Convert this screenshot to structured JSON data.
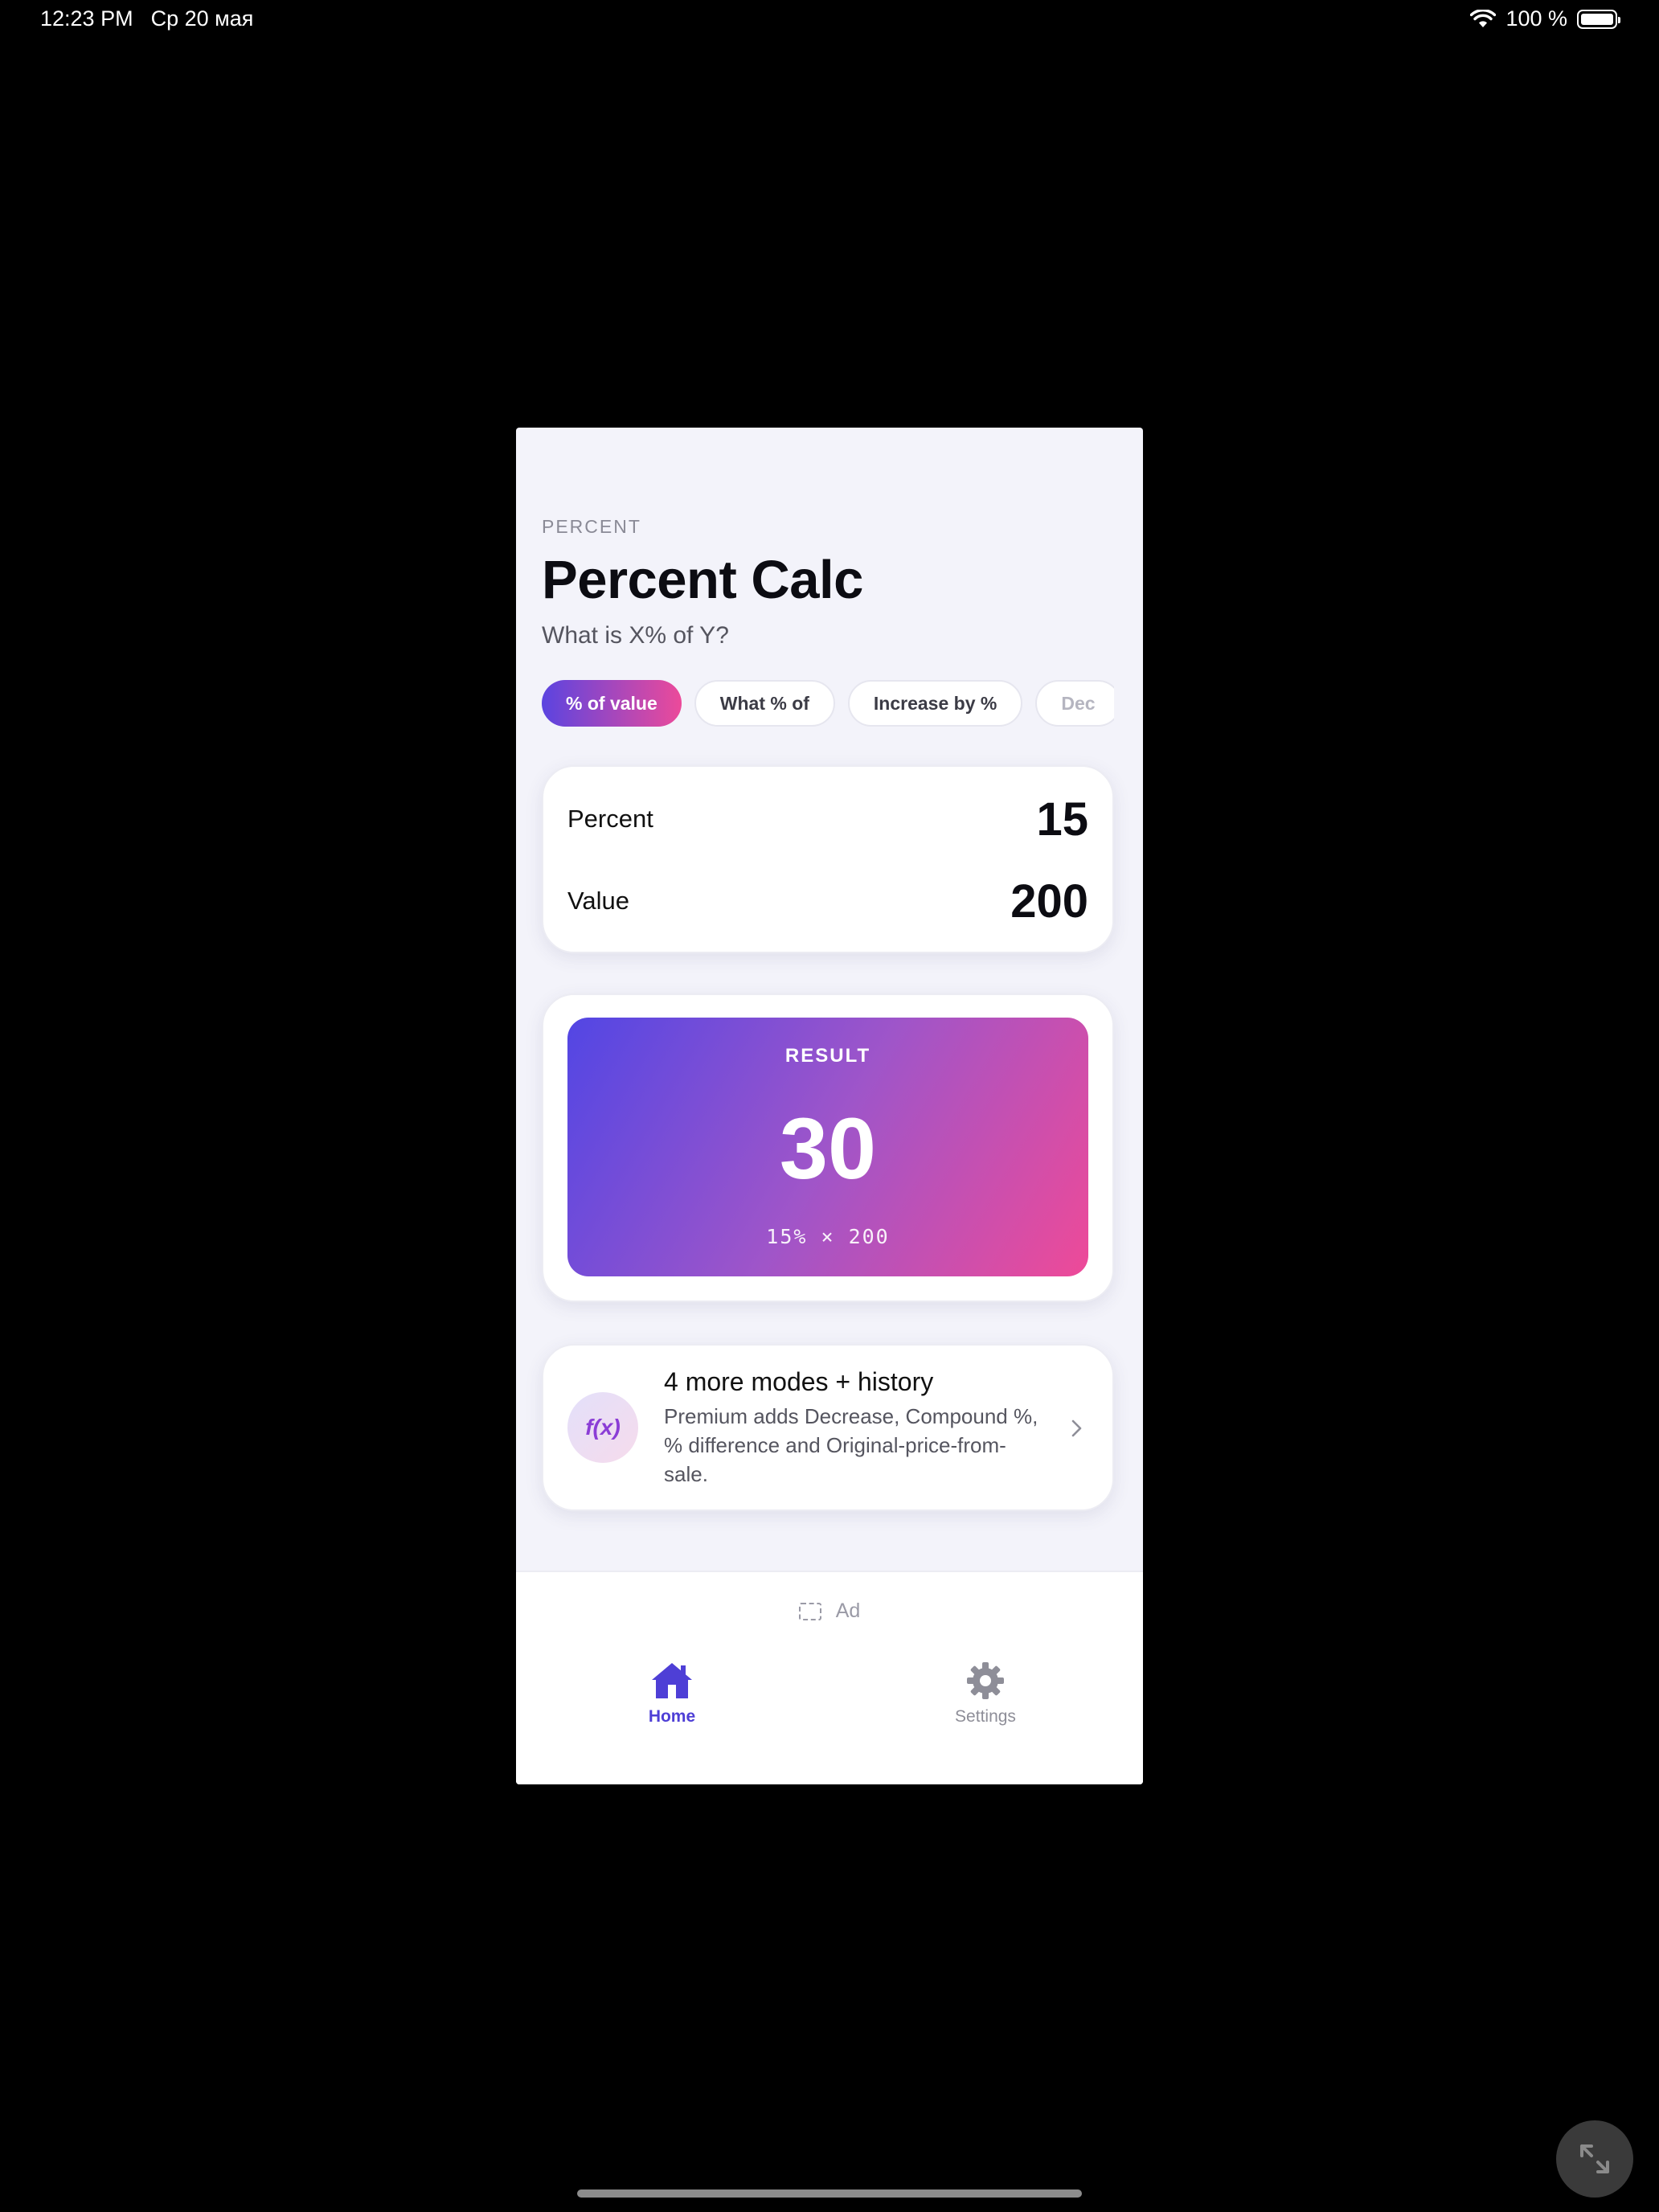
{
  "status_bar": {
    "time": "12:23 PM",
    "date": "Ср 20 мая",
    "battery": "100 %"
  },
  "header": {
    "eyebrow": "PERCENT",
    "title": "Percent Calc",
    "subtitle": "What is X% of Y?"
  },
  "tabs": [
    {
      "label": "% of value",
      "active": true
    },
    {
      "label": "What % of",
      "active": false
    },
    {
      "label": "Increase by %",
      "active": false
    },
    {
      "label": "Dec",
      "active": false
    }
  ],
  "inputs": {
    "percent": {
      "label": "Percent",
      "value": "15"
    },
    "value": {
      "label": "Value",
      "value": "200"
    }
  },
  "result": {
    "label": "RESULT",
    "value": "30",
    "formula": "15% × 200"
  },
  "promo": {
    "icon": "f(x)",
    "title": "4 more modes + history",
    "description": "Premium adds Decrease, Compound %, % difference and Original-price-from-sale."
  },
  "ad": {
    "label": "Ad"
  },
  "nav": {
    "home_label": "Home",
    "settings_label": "Settings"
  },
  "colors": {
    "accent": "#4e3fd6",
    "gradient_start": "#5246e4",
    "gradient_end": "#ee4a98"
  }
}
